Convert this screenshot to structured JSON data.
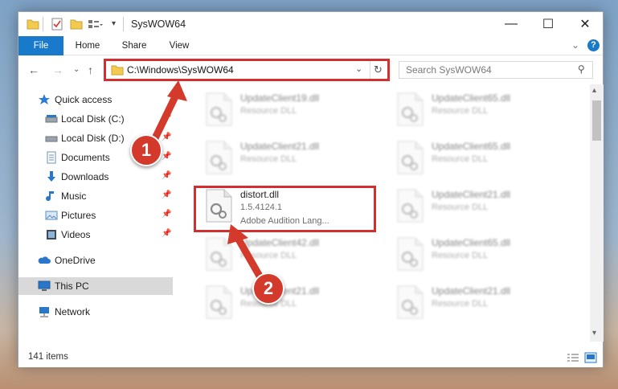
{
  "window": {
    "title": "SysWOW64",
    "buttons": {
      "minimize": "—",
      "maximize": "☐",
      "close": "✕"
    }
  },
  "ribbon": {
    "tabs": [
      {
        "label": "File"
      },
      {
        "label": "Home"
      },
      {
        "label": "Share"
      },
      {
        "label": "View"
      }
    ]
  },
  "address": {
    "path": "C:\\Windows\\SysWOW64",
    "search_placeholder": "Search SysWOW64"
  },
  "nav": {
    "quick_access": "Quick access",
    "items": [
      {
        "label": "Local Disk (C:)",
        "icon": "drive-icon",
        "pinned": true
      },
      {
        "label": "Local Disk (D:)",
        "icon": "drive-icon",
        "pinned": true
      },
      {
        "label": "Documents",
        "icon": "documents-icon",
        "pinned": true
      },
      {
        "label": "Downloads",
        "icon": "downloads-icon",
        "pinned": true
      },
      {
        "label": "Music",
        "icon": "music-icon",
        "pinned": true
      },
      {
        "label": "Pictures",
        "icon": "pictures-icon",
        "pinned": true
      },
      {
        "label": "Videos",
        "icon": "videos-icon",
        "pinned": true
      }
    ],
    "onedrive": "OneDrive",
    "this_pc": "This PC",
    "network": "Network"
  },
  "files": {
    "left_column": [
      {
        "name": "UpdateClient19.dll",
        "desc": "Resource DLL"
      },
      {
        "name": "UpdateClient21.dll",
        "desc": "Resource DLL"
      },
      {
        "name": "distort.dll",
        "version": "1.5.4124.1",
        "desc": "Adobe Audition Lang..."
      },
      {
        "name": "UpdateClient42.dll",
        "desc": "Resource DLL"
      },
      {
        "name": "UpdateClient21.dll",
        "desc": "Resource DLL"
      }
    ],
    "right_column": [
      {
        "name": "UpdateClient65.dll",
        "desc": "Resource DLL"
      },
      {
        "name": "UpdateClient65.dll",
        "desc": "Resource DLL"
      },
      {
        "name": "UpdateClient21.dll",
        "desc": "Resource DLL"
      },
      {
        "name": "UpdateClient65.dll",
        "desc": "Resource DLL"
      },
      {
        "name": "UpdateClient21.dll",
        "desc": "Resource DLL"
      }
    ]
  },
  "status": {
    "item_count": "141 items"
  },
  "callouts": {
    "step1": "1",
    "step2": "2"
  },
  "colors": {
    "accent": "#1979ca",
    "highlight": "#d32f2f",
    "badge": "#d33a2c"
  }
}
